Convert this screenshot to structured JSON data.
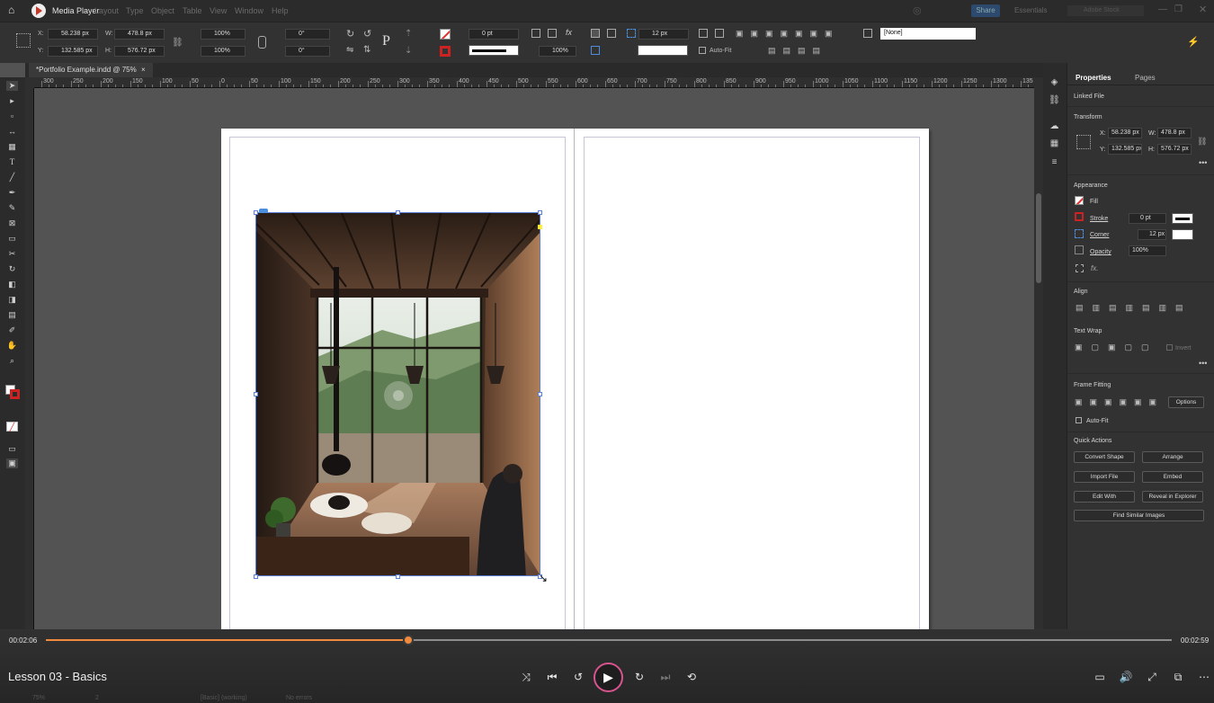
{
  "menubar": {
    "app_name": "Media Player",
    "menus": [
      "Layout",
      "Type",
      "Object",
      "Table",
      "View",
      "Window",
      "Help"
    ],
    "share_label": "Share",
    "workspace_label": "Essentials",
    "search_placeholder": "Adobe Stock"
  },
  "control_bar": {
    "x_label": "X:",
    "x_value": "58.238 px",
    "y_label": "Y:",
    "y_value": "132.585 px",
    "w_label": "W:",
    "w_value": "478.8 px",
    "h_label": "H:",
    "h_value": "576.72 px",
    "scale_x": "100%",
    "scale_y": "100%",
    "rotate": "0°",
    "shear": "0°",
    "stroke_weight": "0 pt",
    "opacity": "100%",
    "corner": "12 px",
    "auto_fit_label": "Auto-Fit",
    "style_value": "[None]"
  },
  "document_tab": {
    "title": "*Portfolio Example.indd @ 75%",
    "close": "×"
  },
  "ruler": {
    "ticks": [
      "300",
      "250",
      "200",
      "150",
      "100",
      "50",
      "0",
      "50",
      "100",
      "150",
      "200",
      "250",
      "300",
      "350",
      "400",
      "450",
      "500",
      "550",
      "600",
      "650",
      "700",
      "750",
      "800",
      "850",
      "900",
      "950",
      "1000",
      "1050",
      "1100",
      "1150",
      "1200",
      "1250",
      "1300",
      "135"
    ]
  },
  "properties_panel": {
    "tabs": [
      "Properties",
      "Pages"
    ],
    "linked_file": "Linked File",
    "transform_title": "Transform",
    "x_label": "X:",
    "x_value": "58.238 px",
    "y_label": "Y:",
    "y_value": "132.585 px",
    "w_label": "W:",
    "w_value": "478.8 px",
    "h_label": "H:",
    "h_value": "576.72 px",
    "appearance_title": "Appearance",
    "fill_label": "Fill",
    "stroke_label": "Stroke",
    "stroke_value": "0 pt",
    "corner_label": "Corner",
    "corner_value": "12 px",
    "opacity_label": "Opacity",
    "opacity_value": "100%",
    "fx_label": "fx.",
    "align_title": "Align",
    "text_wrap_title": "Text Wrap",
    "invert_label": "Invert",
    "frame_fitting_title": "Frame Fitting",
    "options_label": "Options",
    "auto_fit_label": "Auto-Fit",
    "quick_actions_title": "Quick Actions",
    "quick_actions": [
      "Convert Shape",
      "Arrange",
      "Import File",
      "Embed",
      "Edit With",
      "Reveal in Explorer"
    ],
    "find_similar": "Find Similar Images"
  },
  "video": {
    "current_time": "00:02:06",
    "total_time": "00:02:59",
    "progress": 0.322,
    "lesson_title": "Lesson 03 - Basics",
    "accent_color": "#f08a3c"
  },
  "status_bar": {
    "zoom": "75%",
    "page": "2",
    "style": "[Basic] (working)",
    "errors": "No errors"
  }
}
